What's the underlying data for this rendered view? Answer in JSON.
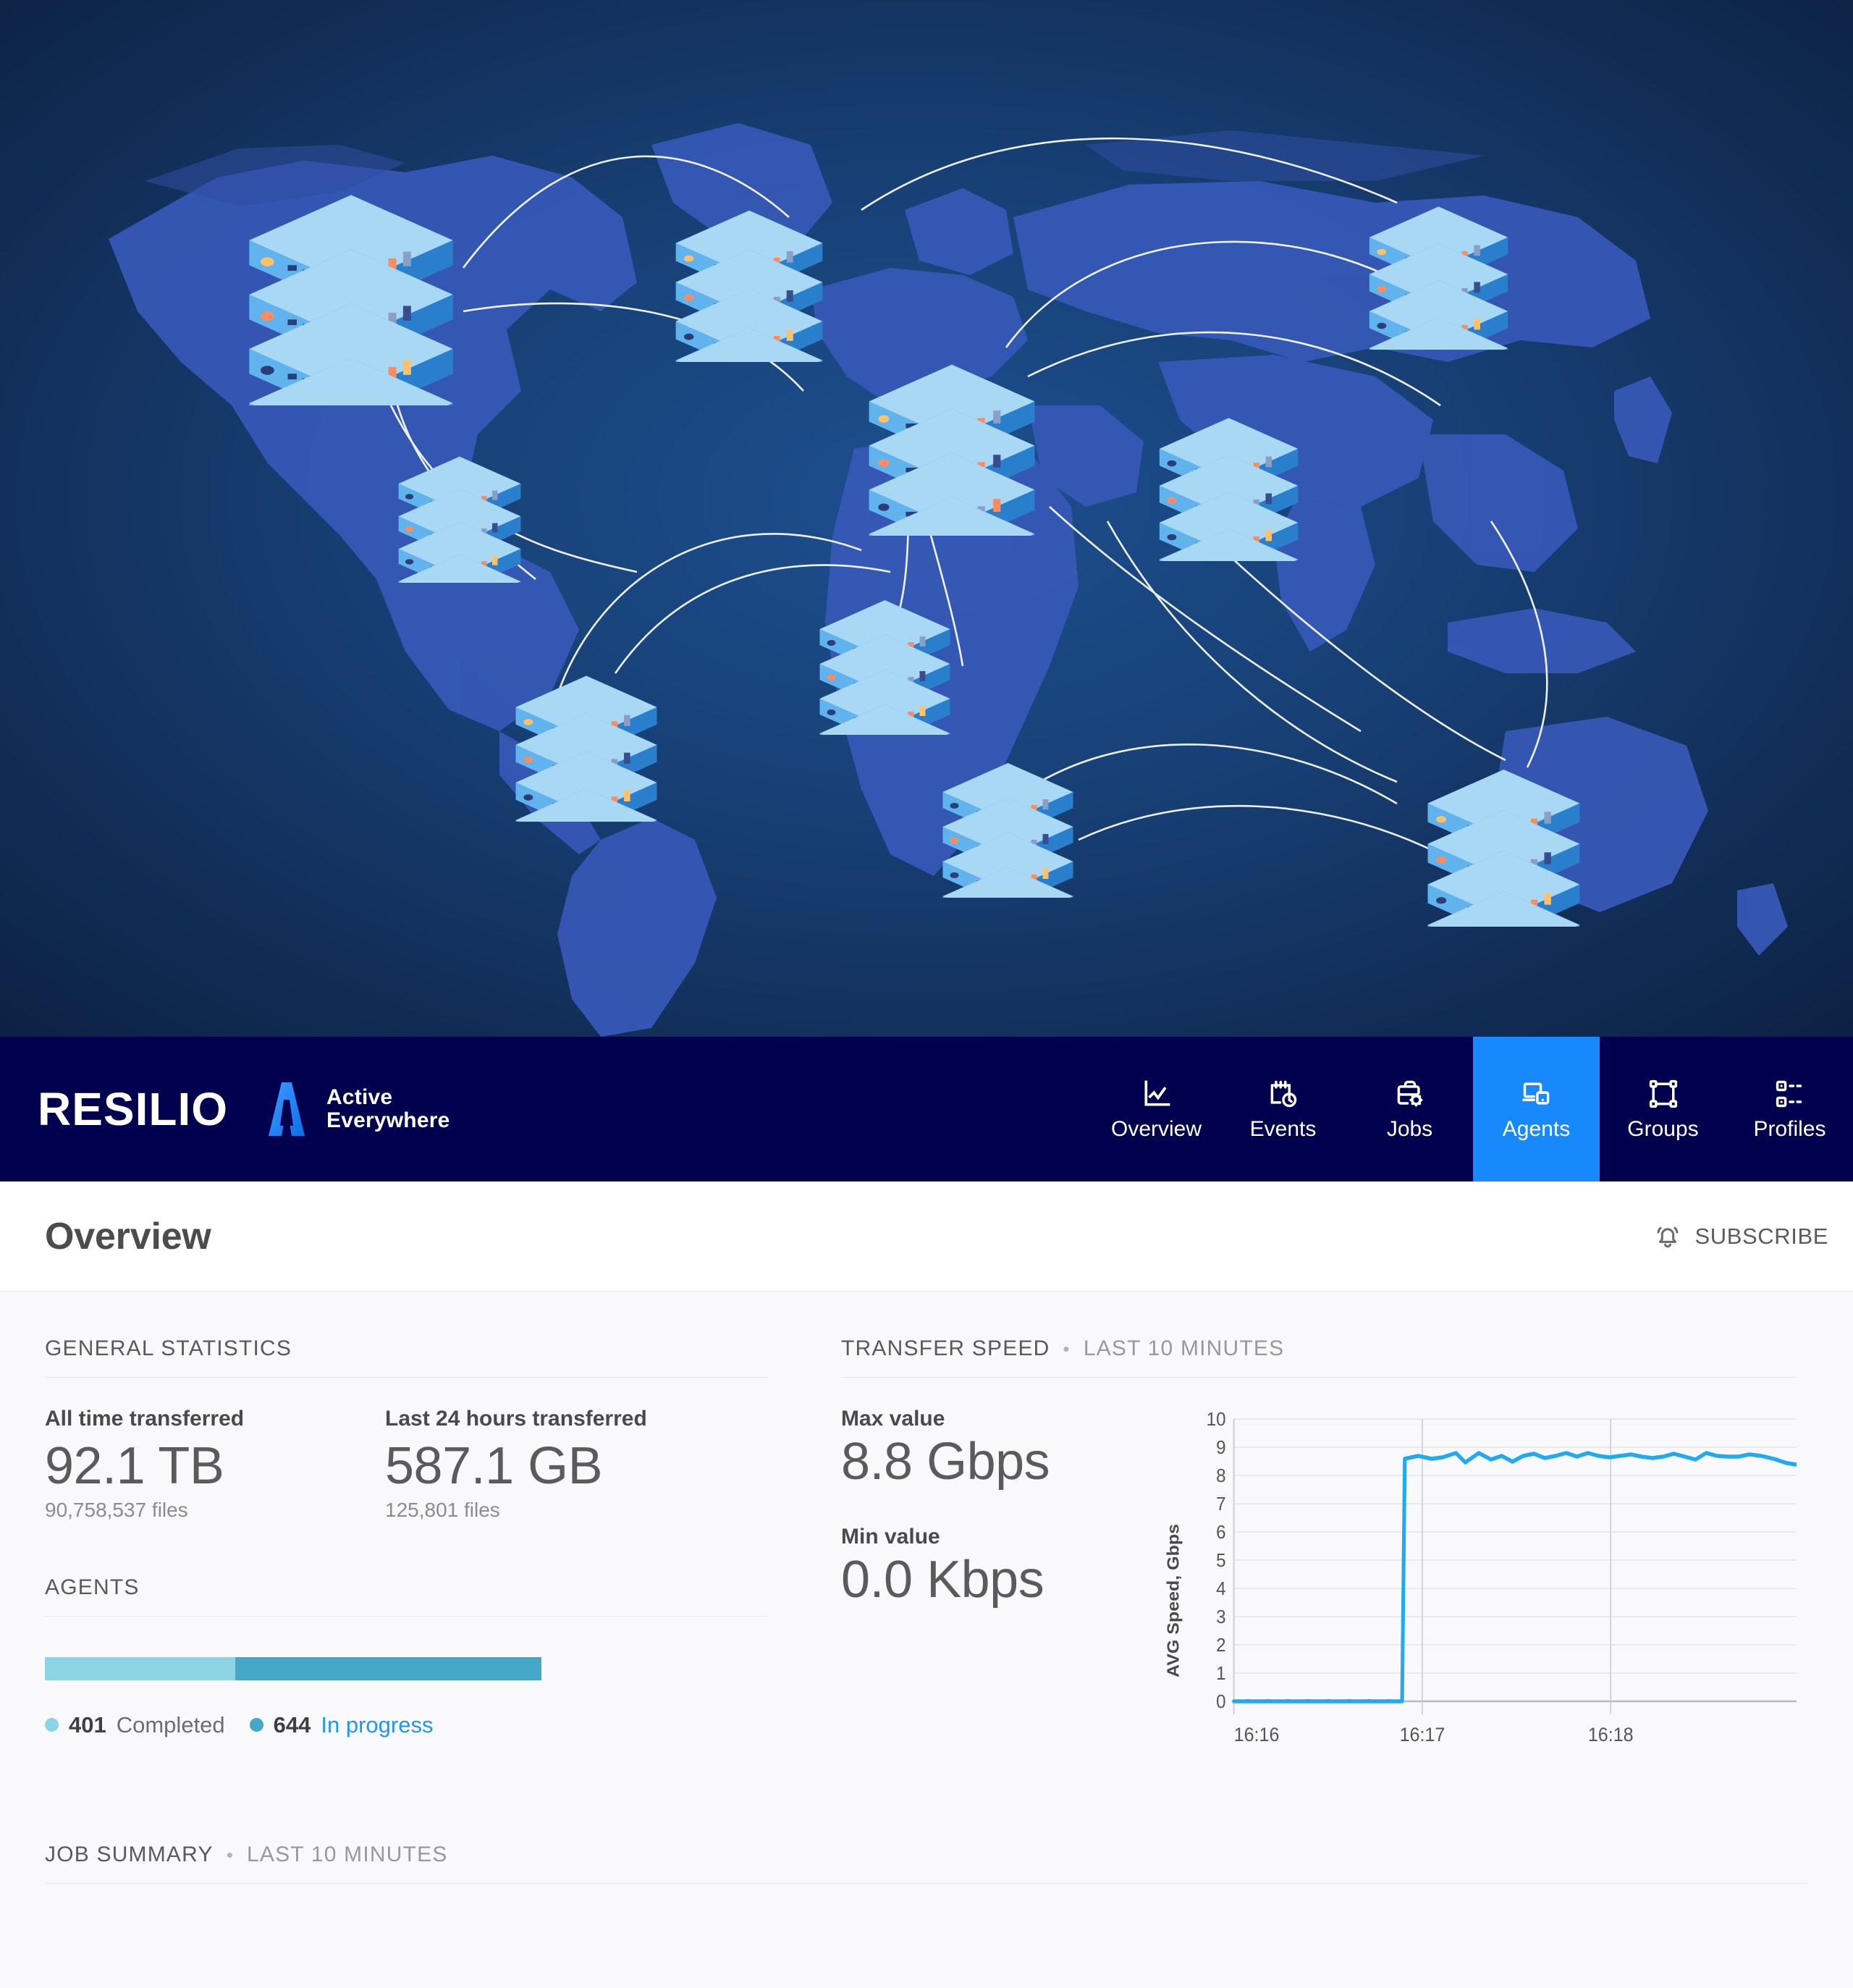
{
  "hero": {
    "alt": "isometric servers over world map",
    "bg_deep": "#071733",
    "bg_mid": "#173f74",
    "map_color": "#3b5fc0",
    "server_top": "#a9d8f5",
    "server_side": "#2f8fe0",
    "link_color": "#ffffff"
  },
  "navbar": {
    "bg": "#00004f",
    "active_bg": "#1789fc",
    "brand": "RESILIO",
    "tagline_line1": "Active",
    "tagline_line2": "Everywhere",
    "items": [
      {
        "label": "Overview",
        "icon": "chart-line-icon",
        "active": false
      },
      {
        "label": "Events",
        "icon": "calendar-clock-icon",
        "active": false
      },
      {
        "label": "Jobs",
        "icon": "briefcase-gear-icon",
        "active": false
      },
      {
        "label": "Agents",
        "icon": "devices-icon",
        "active": true
      },
      {
        "label": "Groups",
        "icon": "group-nodes-icon",
        "active": false
      },
      {
        "label": "Profiles",
        "icon": "profiles-list-icon",
        "active": false
      }
    ]
  },
  "page": {
    "title": "Overview",
    "subscribe_label": "SUBSCRIBE",
    "subscribe_icon": "bell-icon"
  },
  "general_statistics": {
    "heading": "GENERAL STATISTICS",
    "stats": [
      {
        "label": "All time transferred",
        "value": "92.1 TB",
        "files": "90,758,537 files"
      },
      {
        "label": "Last 24 hours transferred",
        "value": "587.1 GB",
        "files": "125,801 files"
      }
    ]
  },
  "agents": {
    "heading": "AGENTS",
    "completed_count": "401",
    "completed_label": "Completed",
    "inprogress_count": "644",
    "inprogress_label": "In progress",
    "completed_pct": 38.4,
    "inprogress_pct": 61.6,
    "completed_color": "#8dd3e6",
    "inprogress_color": "#46a8c8",
    "link_color": "#2196f3"
  },
  "transfer_speed": {
    "heading": "TRANSFER SPEED",
    "separator": "•",
    "period": "LAST 10 MINUTES",
    "max_label": "Max value",
    "max_value": "8.8 Gbps",
    "min_label": "Min value",
    "min_value": "0.0 Kbps"
  },
  "job_summary": {
    "heading": "JOB SUMMARY",
    "separator": "•",
    "period": "LAST 10 MINUTES"
  },
  "chart_data": {
    "type": "line",
    "title": "",
    "xlabel": "",
    "ylabel": "AVG Speed, Gbps",
    "ylim": [
      0,
      10
    ],
    "yticks": [
      0,
      1,
      2,
      3,
      4,
      5,
      6,
      7,
      8,
      9,
      10
    ],
    "xticks": [
      "16:16",
      "16:17",
      "16:18"
    ],
    "grid": true,
    "legend": "none",
    "line_color": "#22aaf0",
    "series": [
      {
        "name": "AVG Speed",
        "x": [
          "16:16",
          "16:16",
          "16:16",
          "16:16",
          "16:16",
          "16:16",
          "16:16",
          "16:16",
          "16:16",
          "16:16",
          "16:16",
          "16:16",
          "16:16",
          "16:16",
          "16:17",
          "16:17",
          "16:17",
          "16:17",
          "16:17",
          "16:17",
          "16:17",
          "16:17",
          "16:17",
          "16:17",
          "16:17",
          "16:17",
          "16:17",
          "16:17",
          "16:17",
          "16:18",
          "16:18",
          "16:18",
          "16:18",
          "16:18",
          "16:18",
          "16:18",
          "16:18",
          "16:18",
          "16:18",
          "16:18",
          "16:18",
          "16:18",
          "16:18",
          "16:18",
          "16:19",
          "16:19",
          "16:19",
          "16:19",
          "16:19"
        ],
        "values": [
          0,
          0,
          0,
          0,
          0,
          0,
          0,
          0,
          0,
          0,
          0,
          0,
          0,
          0,
          8.6,
          8.7,
          8.6,
          8.65,
          8.8,
          8.35,
          8.8,
          8.55,
          8.65,
          8.45,
          8.65,
          8.7,
          8.55,
          8.65,
          8.8,
          8.6,
          8.8,
          8.65,
          8.6,
          8.65,
          8.7,
          8.6,
          8.55,
          8.6,
          8.7,
          8.6,
          8.5,
          8.8,
          8.65,
          8.6,
          8.6,
          8.7,
          8.65,
          8.55,
          8.4
        ]
      }
    ]
  }
}
